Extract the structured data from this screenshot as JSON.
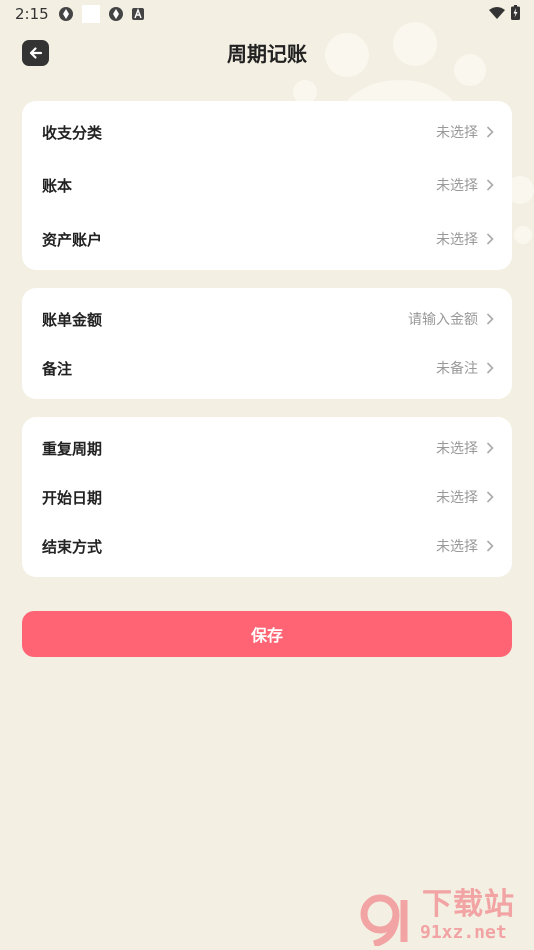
{
  "status_bar": {
    "time": "2:15"
  },
  "header": {
    "title": "周期记账"
  },
  "card1": {
    "rows": [
      {
        "label": "收支分类",
        "value": "未选择"
      },
      {
        "label": "账本",
        "value": "未选择"
      },
      {
        "label": "资产账户",
        "value": "未选择"
      }
    ]
  },
  "card2": {
    "rows": [
      {
        "label": "账单金额",
        "value": "请输入金额"
      },
      {
        "label": "备注",
        "value": "未备注"
      }
    ]
  },
  "card3": {
    "rows": [
      {
        "label": "重复周期",
        "value": "未选择"
      },
      {
        "label": "开始日期",
        "value": "未选择"
      },
      {
        "label": "结束方式",
        "value": "未选择"
      }
    ]
  },
  "save_label": "保存",
  "watermark": {
    "title": "下载站",
    "url": "91xz.net"
  },
  "colors": {
    "background": "#f3efe2",
    "accent": "#fe6474",
    "card": "#ffffff"
  }
}
